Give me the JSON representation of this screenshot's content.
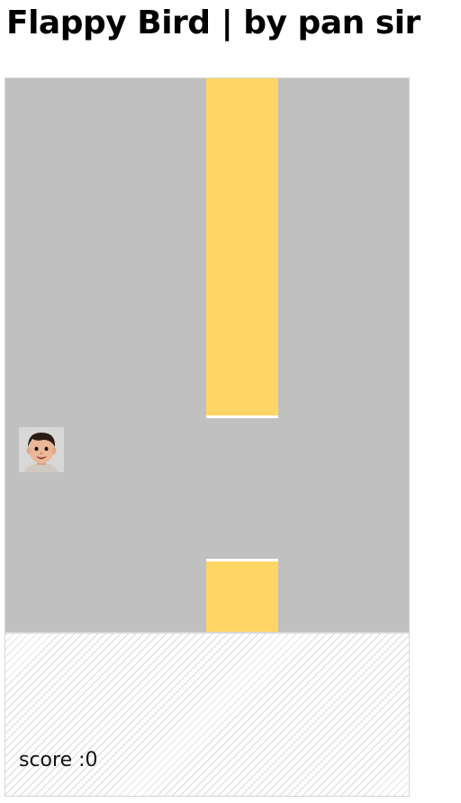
{
  "header": {
    "title": "Flappy Bird | by pan sir"
  },
  "game": {
    "colors": {
      "sky": "#c0c0c0",
      "pipe": "#ffd566",
      "pipe_edge": "#ffffff",
      "ground_stripe": "#d9d9d9"
    },
    "bird": {
      "icon": "child-face-icon"
    },
    "score_label": "score :",
    "score_value": "0"
  }
}
